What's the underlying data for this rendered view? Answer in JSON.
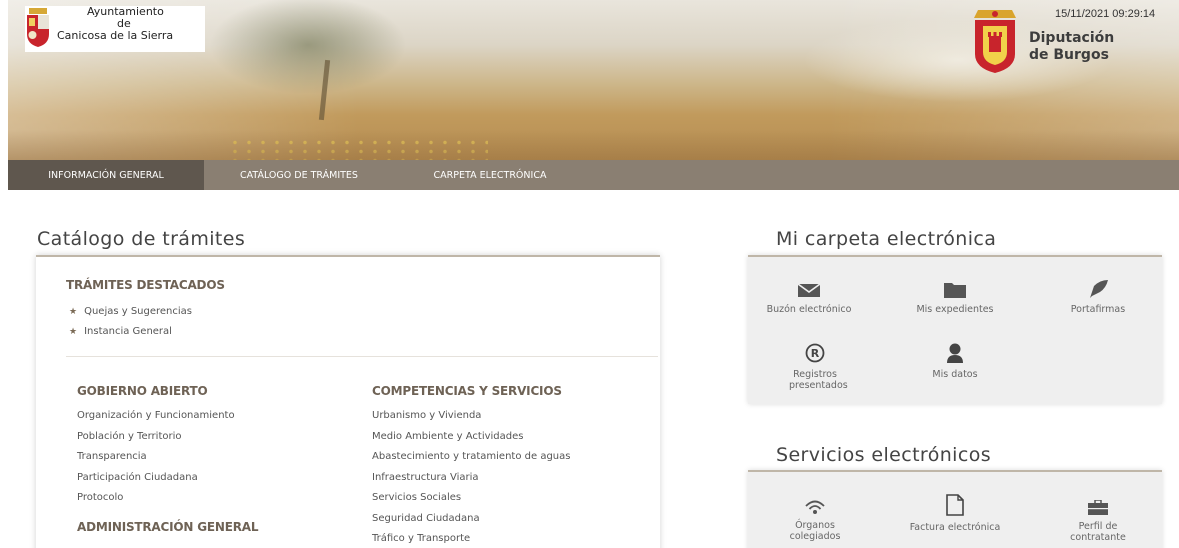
{
  "header": {
    "municipality_lines": [
      "Ayuntamiento",
      "de",
      "Canicosa de la Sierra"
    ],
    "province_lines": [
      "Diputación",
      "de Burgos"
    ],
    "datetime": "15/11/2021 09:29:14"
  },
  "nav": {
    "items": [
      {
        "label": "INFORMACIÓN GENERAL",
        "active": true
      },
      {
        "label": "CATÁLOGO DE TRÁMITES",
        "active": false
      },
      {
        "label": "CARPETA ELECTRÓNICA",
        "active": false
      }
    ]
  },
  "catalog": {
    "title": "Catálogo de trámites",
    "featured_heading": "TRÁMITES DESTACADOS",
    "featured": [
      "Quejas y Sugerencias",
      "Instancia General"
    ],
    "gobierno": {
      "heading": "GOBIERNO ABIERTO",
      "items": [
        "Organización y Funcionamiento",
        "Población y Territorio",
        "Transparencia",
        "Participación Ciudadana",
        "Protocolo"
      ]
    },
    "administracion": {
      "heading": "ADMINISTRACIÓN GENERAL"
    },
    "competencias": {
      "heading": "COMPETENCIAS Y SERVICIOS",
      "items": [
        "Urbanismo y Vivienda",
        "Medio Ambiente y Actividades",
        "Abastecimiento y tratamiento de aguas",
        "Infraestructura Viaria",
        "Servicios Sociales",
        "Seguridad Ciudadana",
        "Tráfico y Transporte"
      ]
    }
  },
  "carpeta": {
    "title": "Mi carpeta electrónica",
    "tiles": [
      {
        "icon": "envelope-icon",
        "label": "Buzón electrónico"
      },
      {
        "icon": "folder-icon",
        "label": "Mis expedientes"
      },
      {
        "icon": "feather-pen-icon",
        "label": "Portafirmas"
      },
      {
        "icon": "registered-icon",
        "label": "Registros presentados"
      },
      {
        "icon": "user-icon",
        "label": "Mis datos"
      }
    ]
  },
  "servicios": {
    "title": "Servicios electrónicos",
    "tiles": [
      {
        "icon": "wifi-icon",
        "label": "Órganos colegiados"
      },
      {
        "icon": "document-icon",
        "label": "Factura electrónica"
      },
      {
        "icon": "briefcase-icon",
        "label": "Perfil de contratante"
      }
    ]
  },
  "colors": {
    "nav_bg": "#8a7f72",
    "nav_active": "#5f574e",
    "heading_brown": "#6e6255",
    "panel_border": "#bfb6a8"
  }
}
